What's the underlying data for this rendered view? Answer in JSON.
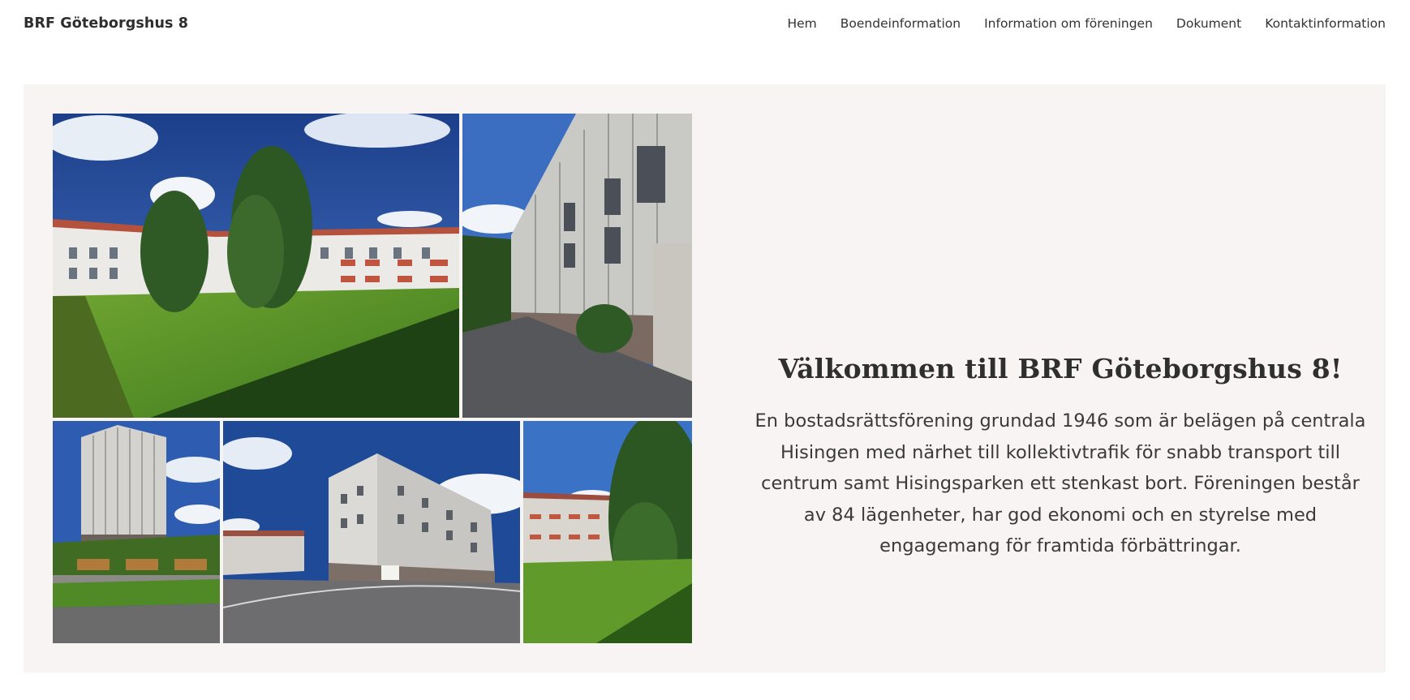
{
  "header": {
    "brand": "BRF Göteborgshus 8",
    "nav": [
      "Hem",
      "Boendeinformation",
      "Information om föreningen",
      "Dokument",
      "Kontaktinformation"
    ]
  },
  "hero": {
    "title": "Välkommen till BRF Göteborgshus 8!",
    "description": "En bostadsrättsförening grundad 1946 som är belägen på centrala Hisingen med närhet till kollektivtrafik för snabb transport till centrum samt Hisingsparken ett stenkast bort. Föreningen består av 84 lägenheter, har god ekonomi och en styrelse med engagemang för framtida förbättringar."
  },
  "colors": {
    "hero_background": "#f9f4f4",
    "text": "#2b2b2b"
  }
}
